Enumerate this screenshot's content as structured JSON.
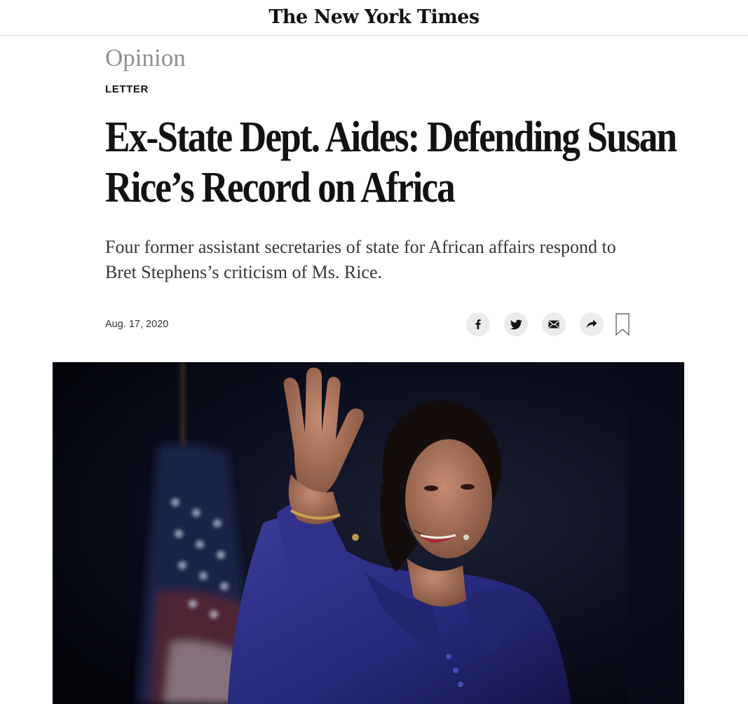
{
  "masthead": {
    "logo_text": "The New York Times"
  },
  "article": {
    "section": "Opinion",
    "label": "LETTER",
    "headline_line1": "Ex-State Dept. Aides: Defending Susan",
    "headline_line2": "Rice’s Record on Africa",
    "summary": "Four former assistant secretaries of state for African affairs respond to Bret Stephens’s criticism of Ms. Rice.",
    "date": "Aug. 17, 2020"
  },
  "share_tools": {
    "facebook_icon": "facebook-icon",
    "twitter_icon": "twitter-icon",
    "email_icon": "email-icon",
    "share_icon": "share-arrow-icon",
    "bookmark_icon": "bookmark-icon"
  },
  "colors": {
    "text": "#121212",
    "kicker": "#8f8f8f",
    "share_button_bg": "#ebebeb",
    "photo_background": "#05070f",
    "coat": "#2b2d7a"
  }
}
